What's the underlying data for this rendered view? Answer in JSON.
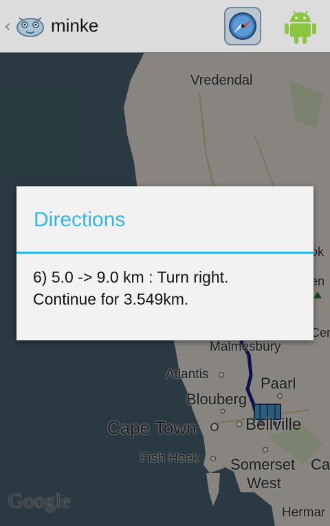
{
  "actionbar": {
    "title": "minke",
    "back_glyph": "‹",
    "app_icon": "minke-whale-icon",
    "compass_icon": "compass-icon",
    "android_icon": "android-icon"
  },
  "map": {
    "labels": {
      "vredendal": "Vredendal",
      "malmesbury": "Malmesbury",
      "atlantis": "Atlantis",
      "paarl": "Paarl",
      "blouberg": "Blouberg",
      "cape_town": "Cape Town",
      "bellville": "Bellville",
      "fish_hoek": "Fish Hoek",
      "somerset": "Somerset",
      "west": "West",
      "ca": "Ca",
      "hermar": "Hermar",
      "ok": "ok",
      "en": "en",
      "cer": "Cer"
    },
    "attribution": "Google",
    "colors": {
      "sea": "#4a6572",
      "land": "#eae6dc",
      "route": "#1a1a8c"
    }
  },
  "dialog": {
    "title": "Directions",
    "message_line1": "6) 5.0 -> 9.0 km : Turn right.",
    "message_line2": "Continue for 3.549km.",
    "accent": "#33b5e5"
  }
}
